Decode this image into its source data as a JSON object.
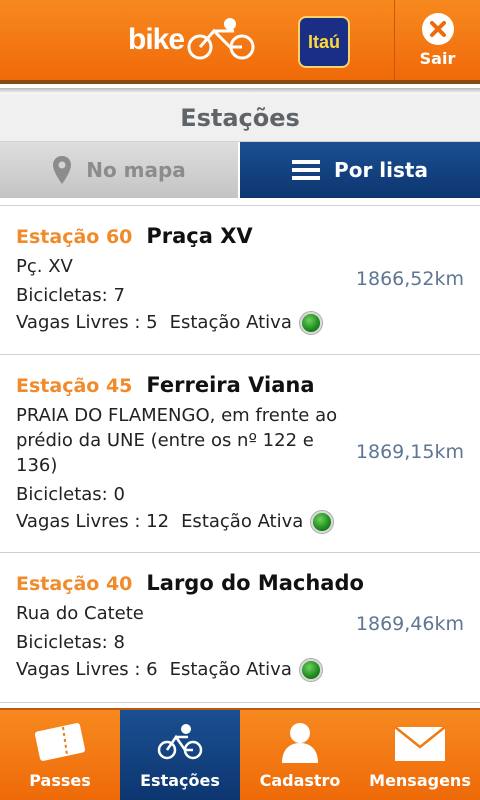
{
  "header": {
    "logo_text": "bike",
    "sponsor_text": "Itaú",
    "exit_label": "Sair",
    "accent_color": "#f37a14",
    "primary_color": "#0f3d7a"
  },
  "title": "Estações",
  "view_toggle": {
    "map_label": "No mapa",
    "list_label": "Por lista",
    "selected": "list"
  },
  "stations": [
    {
      "number": "Estação 60",
      "name": "Praça XV",
      "address": "Pç. XV",
      "bikes": "Bicicletas: 7",
      "free": "Vagas Livres : 5",
      "status": "Estação Ativa",
      "distance": "1866,52km"
    },
    {
      "number": "Estação 45",
      "name": "Ferreira Viana",
      "address": "PRAIA DO FLAMENGO, em frente ao prédio da UNE (entre os nº 122 e 136)",
      "bikes": "Bicicletas: 0",
      "free": "Vagas Livres : 12",
      "status": "Estação Ativa",
      "distance": "1869,15km"
    },
    {
      "number": "Estação 40",
      "name": "Largo do Machado",
      "address": "Rua do Catete",
      "bikes": "Bicicletas: 8",
      "free": "Vagas Livres : 6",
      "status": "Estação Ativa",
      "distance": "1869,46km"
    }
  ],
  "bottom_nav": [
    {
      "label": "Passes",
      "icon": "ticket-icon",
      "active": false
    },
    {
      "label": "Estações",
      "icon": "bike-icon",
      "active": true
    },
    {
      "label": "Cadastro",
      "icon": "person-icon",
      "active": false
    },
    {
      "label": "Mensagens",
      "icon": "envelope-icon",
      "active": false
    }
  ]
}
